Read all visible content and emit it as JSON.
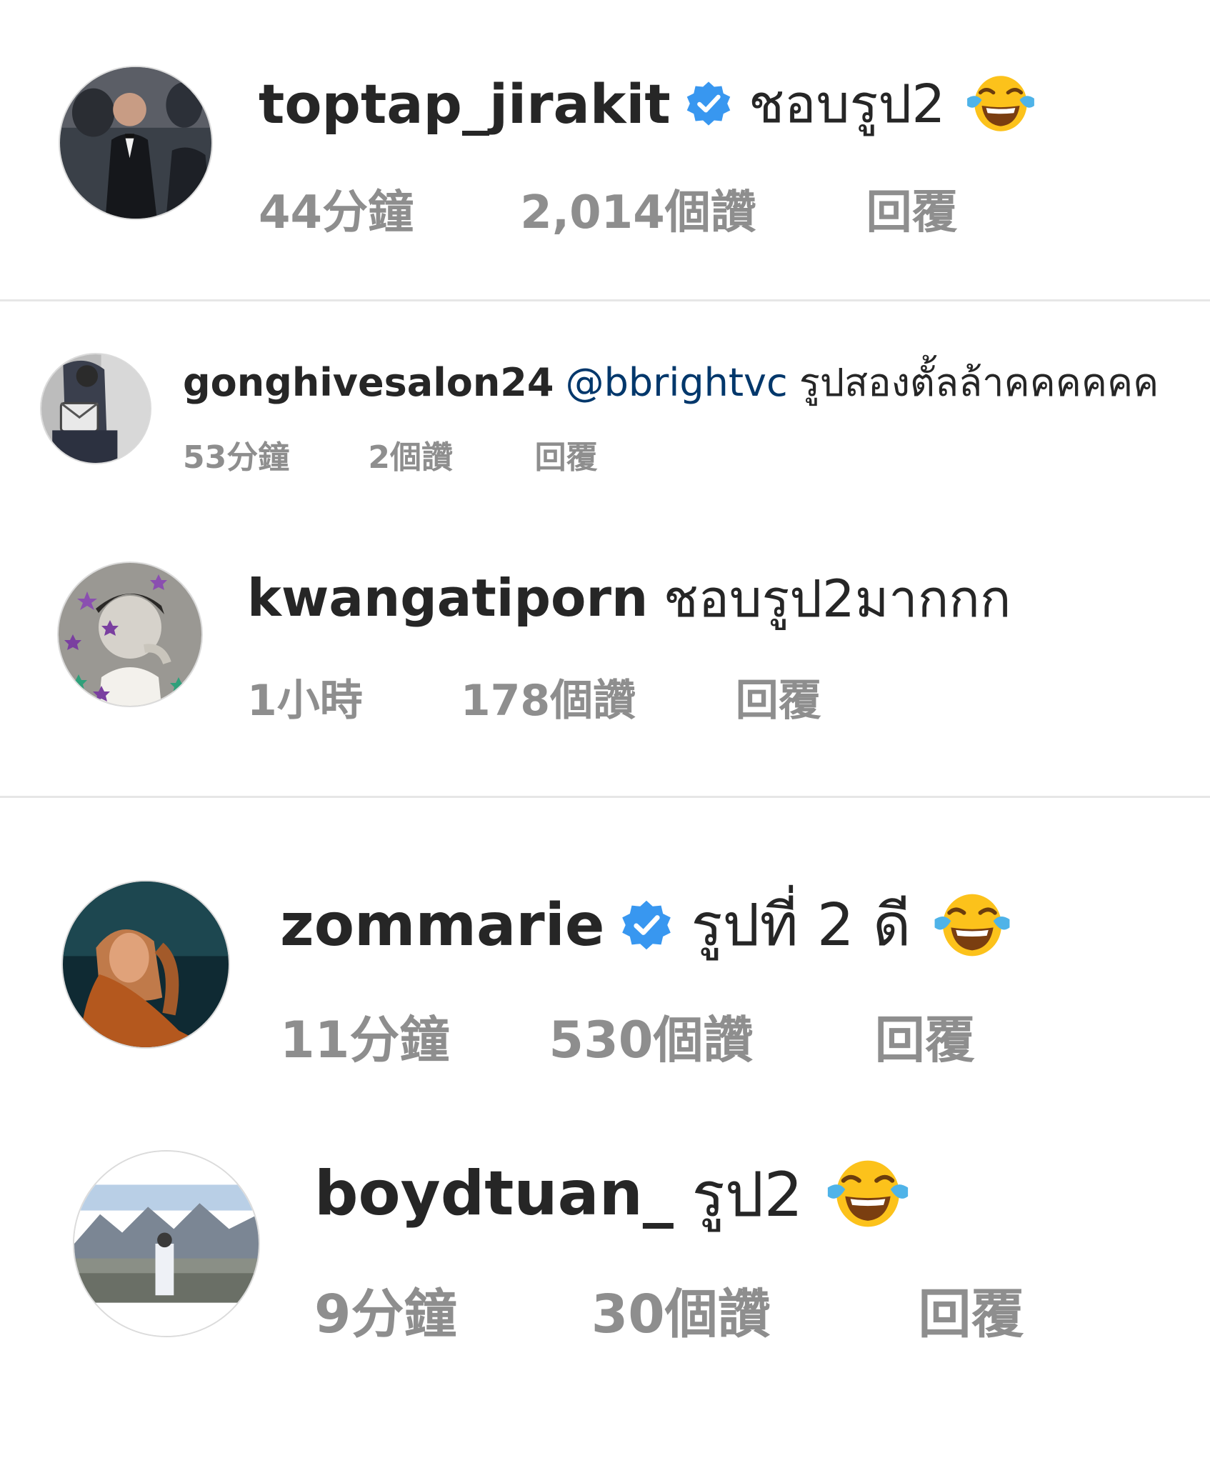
{
  "comments": [
    {
      "username": "toptap_jirakit",
      "verified": true,
      "text": "ชอบรูป2",
      "emoji": "tears-of-joy-emoji",
      "time": "44分鐘",
      "likes": "2,014個讚",
      "reply": "回覆"
    },
    {
      "username": "gonghivesalon24",
      "verified": false,
      "mention": "@bbrightvc",
      "text": "รูปสองตั้ลล้าคคคคคค",
      "time": "53分鐘",
      "likes": "2個讚",
      "reply": "回覆"
    },
    {
      "username": "kwangatiporn",
      "verified": false,
      "text": "ชอบรูป2มากกก",
      "time": "1小時",
      "likes": "178個讚",
      "reply": "回覆"
    },
    {
      "username": "zommarie",
      "verified": true,
      "text": "รูปที่ 2 ดี",
      "emoji": "tears-of-joy-emoji",
      "time": "11分鐘",
      "likes": "530個讚",
      "reply": "回覆"
    },
    {
      "username": "boydtuan_",
      "verified": false,
      "text": "รูป2",
      "emoji": "tears-of-joy-emoji",
      "time": "9分鐘",
      "likes": "30個讚",
      "reply": "回覆"
    }
  ],
  "colors": {
    "username": "#262626",
    "meta": "#8e8e8e",
    "mention": "#00376b",
    "verified": "#3897f0",
    "divider": "#e6e6e6"
  },
  "icons": {
    "verified": "verified-badge-icon",
    "emoji": "face-with-tears-of-joy"
  }
}
